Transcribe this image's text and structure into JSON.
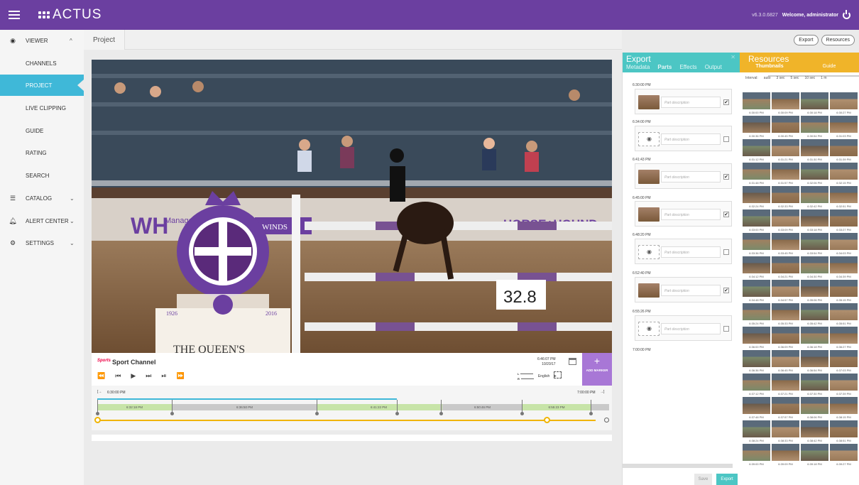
{
  "app": {
    "logo_text": "ACTUS",
    "version": "v6.3.0.6827",
    "welcome": "Welcome, administrator"
  },
  "sidebar": {
    "items": [
      {
        "label": "VIEWER",
        "icon": "eye-icon",
        "chevron": "^"
      },
      {
        "label": "CHANNELS"
      },
      {
        "label": "PROJECT",
        "active": true
      },
      {
        "label": "LIVE CLIPPING"
      },
      {
        "label": "GUIDE"
      },
      {
        "label": "RATING"
      },
      {
        "label": "SEARCH"
      },
      {
        "label": "CATALOG",
        "icon": "list-icon",
        "chevron": "⌄"
      },
      {
        "label": "ALERT CENTER",
        "icon": "bell-icon",
        "chevron": "⌄"
      },
      {
        "label": "SETTINGS",
        "icon": "gear-icon",
        "chevron": "⌄"
      }
    ]
  },
  "breadcrumb": {
    "tab": "Project"
  },
  "top_buttons": {
    "export": "Export",
    "resources": "Resources"
  },
  "video": {
    "banner_left": "WH",
    "banner_left_small": "Managem Group",
    "banner_windsor": "WINDS",
    "banner_right": "HORSE+HOUND",
    "score": "32.8",
    "crest_text": "THE QUEEN'S",
    "crest_years": [
      "1926",
      "2016"
    ]
  },
  "player": {
    "channel_logo": "Sports",
    "channel_name": "Sport Channel",
    "clock_time": "6:46:07 PM",
    "clock_date": "10/20/17",
    "lang_l": "L",
    "lang_r": "R",
    "language": "English",
    "add_marker": "ADD MARKER",
    "buttons": [
      "⏪",
      "⏮",
      "▶",
      "⏭",
      "⏯",
      "⏩"
    ]
  },
  "timeline": {
    "start": "6:30:00 PM",
    "end": "7:00:00 PM",
    "segments": [
      "6:32:18 PM",
      "6:36:50 PM",
      "6:41:22 PM",
      "6:45:55 PM",
      "6:50:46 PM",
      "6:55:23 PM"
    ]
  },
  "export_panel": {
    "title": "Export",
    "tabs": [
      "Metadata",
      "Parts",
      "Effects",
      "Output"
    ],
    "active_tab": "Parts",
    "placeholder": "Part description",
    "parts": [
      {
        "time": "6:30:00 PM",
        "type": "thumb",
        "checked": "✔"
      },
      {
        "time": "6:34:00 PM",
        "type": "camera",
        "checked": ""
      },
      {
        "time": "6:41:43 PM",
        "type": "thumb",
        "checked": "✔"
      },
      {
        "time": "6:45:00 PM",
        "type": "thumb",
        "checked": "✔"
      },
      {
        "time": "6:48:20 PM",
        "type": "camera",
        "checked": ""
      },
      {
        "time": "6:52:40 PM",
        "type": "thumb",
        "checked": "✔"
      },
      {
        "time": "6:55:26 PM",
        "type": "camera",
        "checked": ""
      }
    ],
    "end_time": "7:00:00 PM",
    "save": "Save",
    "export": "Export"
  },
  "resources_panel": {
    "title": "Resources",
    "tabs": [
      "Thumbnails",
      "Guide"
    ],
    "interval_label": "Interval:",
    "interval_options": [
      "auto",
      "3 sec",
      "5 sec",
      "10 sec",
      "1 m"
    ],
    "thumbs": [
      "6:30:00 PM",
      "6:30:09 PM",
      "6:30:18 PM",
      "6:30:27 PM",
      "6:30:36 PM",
      "6:30:45 PM",
      "6:30:54 PM",
      "6:31:03 PM",
      "6:31:12 PM",
      "6:31:21 PM",
      "6:31:30 PM",
      "6:31:39 PM",
      "6:31:48 PM",
      "6:31:57 PM",
      "6:32:06 PM",
      "6:32:15 PM",
      "6:32:24 PM",
      "6:32:33 PM",
      "6:32:42 PM",
      "6:32:51 PM",
      "6:33:00 PM",
      "6:33:09 PM",
      "6:33:18 PM",
      "6:33:27 PM",
      "6:33:36 PM",
      "6:33:45 PM",
      "6:33:54 PM",
      "6:34:03 PM",
      "6:34:12 PM",
      "6:34:21 PM",
      "6:34:30 PM",
      "6:34:39 PM",
      "6:34:48 PM",
      "6:34:57 PM",
      "6:35:06 PM",
      "6:35:15 PM",
      "6:35:24 PM",
      "6:35:33 PM",
      "6:35:42 PM",
      "6:35:51 PM",
      "6:36:00 PM",
      "6:36:09 PM",
      "6:36:18 PM",
      "6:36:27 PM",
      "6:36:36 PM",
      "6:36:45 PM",
      "6:36:54 PM",
      "6:37:03 PM",
      "6:37:12 PM",
      "6:37:21 PM",
      "6:37:30 PM",
      "6:37:39 PM",
      "6:37:48 PM",
      "6:37:57 PM",
      "6:38:06 PM",
      "6:38:15 PM",
      "6:38:24 PM",
      "6:38:33 PM",
      "6:38:42 PM",
      "6:38:51 PM",
      "6:39:00 PM",
      "6:39:09 PM",
      "6:39:18 PM",
      "6:39:27 PM"
    ]
  }
}
